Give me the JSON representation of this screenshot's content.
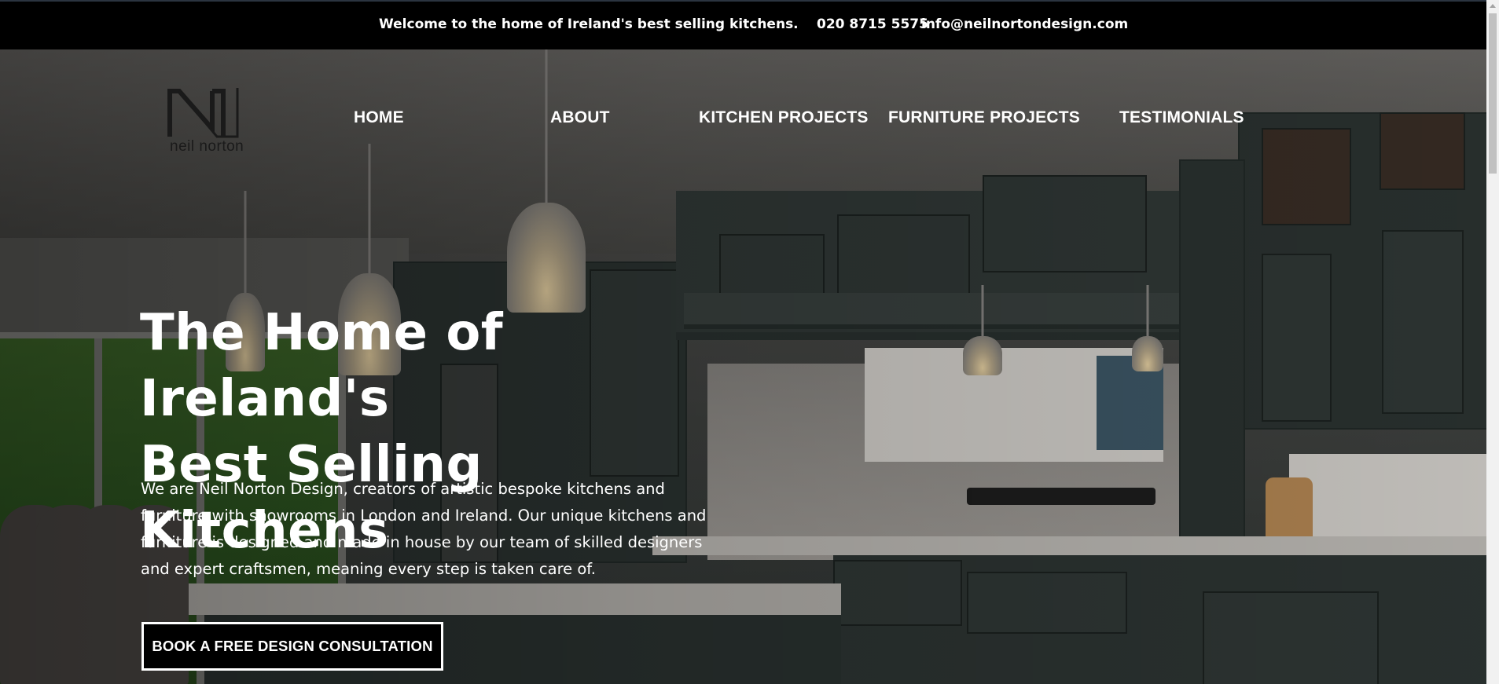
{
  "topbar": {
    "welcome": "Welcome to the home of Ireland's best selling kitchens.",
    "phone": "020 8715 5575",
    "email": "info@neilnortondesign.com"
  },
  "logo": {
    "text": "neil norton"
  },
  "nav": {
    "items": [
      {
        "label": "HOME"
      },
      {
        "label": "ABOUT"
      },
      {
        "label": "KITCHEN PROJECTS"
      },
      {
        "label": "FURNITURE PROJECTS"
      },
      {
        "label": "TESTIMONIALS"
      }
    ]
  },
  "hero": {
    "title_line1": "The Home of Ireland's",
    "title_line2": "Best Selling Kitchens",
    "description": "We are Neil Norton Design, creators of artistic bespoke kitchens and furniture with showrooms in London and Ireland. Our unique kitchens and furniture is designed and made in house by our team of skilled designers and expert craftsmen, meaning every step is taken care of.",
    "cta_label": "BOOK A FREE DESIGN CONSULTATION"
  },
  "colors": {
    "topbar_bg": "#000000",
    "text": "#ffffff",
    "cta_bg": "#000000",
    "cabinet": "#2c3432"
  }
}
